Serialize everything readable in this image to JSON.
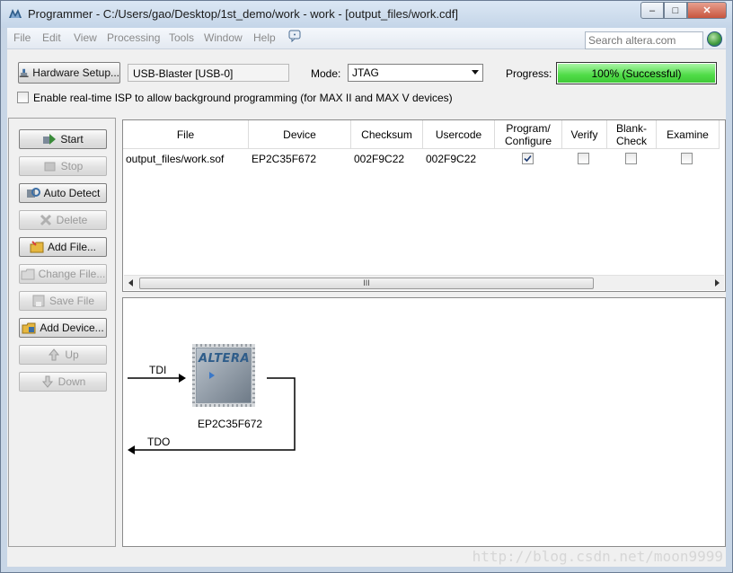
{
  "window": {
    "title": "Programmer - C:/Users/gao/Desktop/1st_demo/work - work - [output_files/work.cdf]",
    "controls": {
      "minimize": "–",
      "maximize": "□",
      "close": "✕"
    }
  },
  "menubar": {
    "items": [
      "File",
      "Edit",
      "View",
      "Processing",
      "Tools",
      "Window",
      "Help"
    ],
    "search_placeholder": "Search altera.com"
  },
  "toolbar": {
    "hardware_setup_label": "Hardware Setup...",
    "hardware_value": "USB-Blaster [USB-0]",
    "mode_label": "Mode:",
    "mode_value": "JTAG",
    "progress_label": "Progress:",
    "progress_text": "100% (Successful)",
    "progress_fraction": 1.0,
    "progress_color": "#4fdc47",
    "isp_label": "Enable real-time ISP to allow background programming (for MAX II and MAX V devices)",
    "isp_checked": false
  },
  "sidebar": {
    "buttons": [
      {
        "label": "Start",
        "enabled": true,
        "icon": "start-icon"
      },
      {
        "label": "Stop",
        "enabled": false,
        "icon": "stop-icon"
      },
      {
        "label": "Auto Detect",
        "enabled": true,
        "icon": "auto-detect-icon"
      },
      {
        "label": "Delete",
        "enabled": false,
        "icon": "delete-icon"
      },
      {
        "label": "Add File...",
        "enabled": true,
        "icon": "add-file-icon"
      },
      {
        "label": "Change File...",
        "enabled": false,
        "icon": "change-file-icon"
      },
      {
        "label": "Save File",
        "enabled": false,
        "icon": "save-file-icon"
      },
      {
        "label": "Add Device...",
        "enabled": true,
        "icon": "add-device-icon"
      },
      {
        "label": "Up",
        "enabled": false,
        "icon": "up-arrow-icon"
      },
      {
        "label": "Down",
        "enabled": false,
        "icon": "down-arrow-icon"
      }
    ]
  },
  "table": {
    "columns": {
      "file": "File",
      "device": "Device",
      "checksum": "Checksum",
      "usercode": "Usercode",
      "program": "Program/ Configure",
      "verify": "Verify",
      "blank_check": "Blank- Check",
      "examine": "Examine"
    },
    "rows": [
      {
        "file": "output_files/work.sof",
        "device": "EP2C35F672",
        "checksum": "002F9C22",
        "usercode": "002F9C22",
        "program": true,
        "verify": false,
        "blank_check": false,
        "examine": false
      }
    ],
    "scroll_thumb_grip": "III"
  },
  "diagram": {
    "tdi_label": "TDI",
    "tdo_label": "TDO",
    "chip_brand": "ALTERA",
    "chip_name": "EP2C35F672"
  },
  "watermark": "http://blog.csdn.net/moon9999",
  "colors": {
    "accent": "#2f5d8a",
    "progress_green": "#4fdc47"
  }
}
